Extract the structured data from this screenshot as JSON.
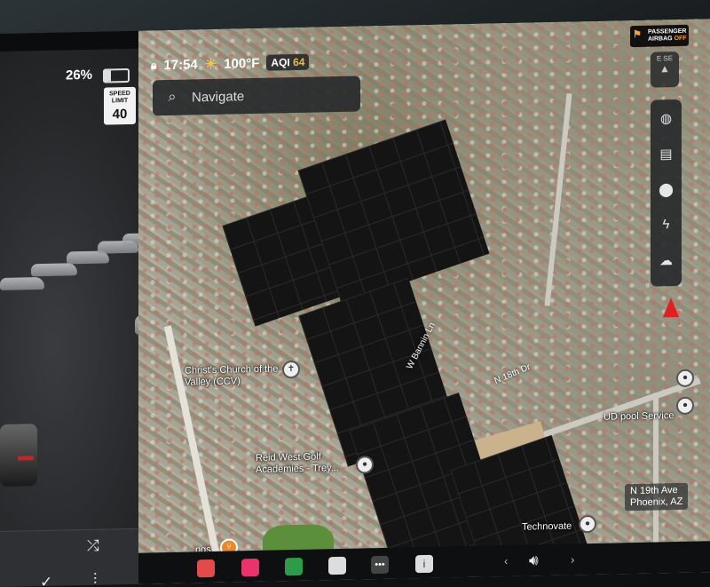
{
  "status": {
    "battery_percent": "26%",
    "battery_level": 0.26,
    "time": "17:54",
    "temperature": "100°F",
    "aqi_label": "AQI",
    "aqi_value": "64"
  },
  "speed_limit": {
    "title": "SPEED LIMIT",
    "value": "40"
  },
  "search": {
    "placeholder": "Navigate"
  },
  "airbag": {
    "line1": "PASSENGER",
    "line2": "AIRBAG",
    "state": "OFF"
  },
  "compass": {
    "letters": "E SE"
  },
  "map_labels": {
    "church": "Christ's Church of the Valley (CCV)",
    "golf": "Reid West Golf Academies - Trey...",
    "pool": "UD pool Service",
    "technovate": "Technovate",
    "address_line1": "N 19th Ave",
    "address_line2": "Phoenix, AZ",
    "street_w_bannin": "W Bannin Ln",
    "street_n18": "N 18th Dr",
    "partial_label": "ngs"
  },
  "toolbar_icons": [
    "globe-icon",
    "traffic-icon",
    "location-pin-icon",
    "charging-bolt-icon",
    "weather-cloud-icon"
  ],
  "media_icons": [
    "shuffle-icon",
    "repeat-icon",
    "check-icon",
    "equalizer-icon",
    "search-icon"
  ],
  "colors": {
    "heading_arrow": "#e02020",
    "aqi_value": "#f0c030",
    "airbag_off": "#f0a040"
  }
}
